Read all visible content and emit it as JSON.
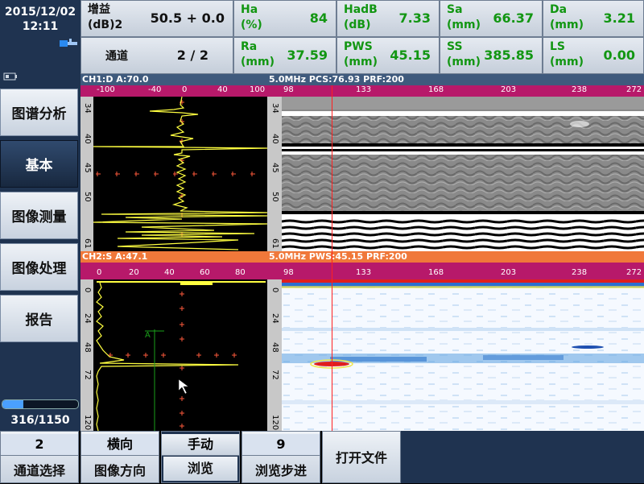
{
  "status": {
    "date": "2015/12/02",
    "time": "12:11",
    "usb_icon": "usb-icon",
    "battery_icon": "battery-icon"
  },
  "nav": [
    {
      "label": "图谱分析",
      "active": false
    },
    {
      "label": "基本",
      "active": true
    },
    {
      "label": "图像测量",
      "active": false
    },
    {
      "label": "图像处理",
      "active": false
    },
    {
      "label": "报告",
      "active": false
    }
  ],
  "progress": {
    "text": "316/1150",
    "fraction": 0.275
  },
  "params": {
    "gain": {
      "label1": "增益",
      "label2": "(dB)2",
      "value": "50.5 + 0.0"
    },
    "channel": {
      "label": "通道",
      "value": "2 / 2"
    },
    "ha": {
      "label1": "Ha",
      "label2": "(%)",
      "value": "84"
    },
    "hadb": {
      "label1": "HadB",
      "label2": "(dB)",
      "value": "7.33"
    },
    "sa": {
      "label1": "Sa",
      "label2": "(mm)",
      "value": "66.37"
    },
    "da": {
      "label1": "Da",
      "label2": "(mm)",
      "value": "3.21"
    },
    "ra": {
      "label1": "Ra",
      "label2": "(mm)",
      "value": "37.59"
    },
    "pws": {
      "label1": "PWS",
      "label2": "(mm)",
      "value": "45.15"
    },
    "ss": {
      "label1": "SS",
      "label2": "(mm)",
      "value": "385.85"
    },
    "ls": {
      "label1": "LS",
      "label2": "(mm)",
      "value": "0.00"
    }
  },
  "ch1": {
    "left": "CH1:D   A:70.0",
    "right": "5.0MHz  PCS:76.93  PRF:200",
    "ascan_ticks": [
      "-100",
      "-40",
      "0",
      "40",
      "100"
    ],
    "depth_ticks": [
      "34",
      "40",
      "45",
      "50",
      "61"
    ],
    "bscan_ticks": [
      "98",
      "133",
      "168",
      "203",
      "238",
      "272"
    ]
  },
  "ch2": {
    "left": "CH2:S   A:47.1",
    "right": "5.0MHz  PWS:45.15  PRF:200",
    "ascan_ticks": [
      "0",
      "20",
      "40",
      "60",
      "80"
    ],
    "depth_ticks": [
      "0",
      "24",
      "48",
      "72",
      "120"
    ],
    "bscan_ticks": [
      "98",
      "133",
      "168",
      "203",
      "238",
      "272"
    ]
  },
  "bottom": [
    {
      "value": "2",
      "label": "通道选择"
    },
    {
      "value": "横向",
      "label": "图像方向"
    },
    {
      "value": "手动",
      "label": "浏览"
    },
    {
      "value": "9",
      "label": "浏览步进"
    },
    {
      "value": "",
      "label": "打开文件"
    }
  ],
  "colors": {
    "accent_red": "#ff2020",
    "ruler": "#b7196a",
    "ch2_bar": "#f0783a",
    "ascan_trace": "#ffff40"
  }
}
